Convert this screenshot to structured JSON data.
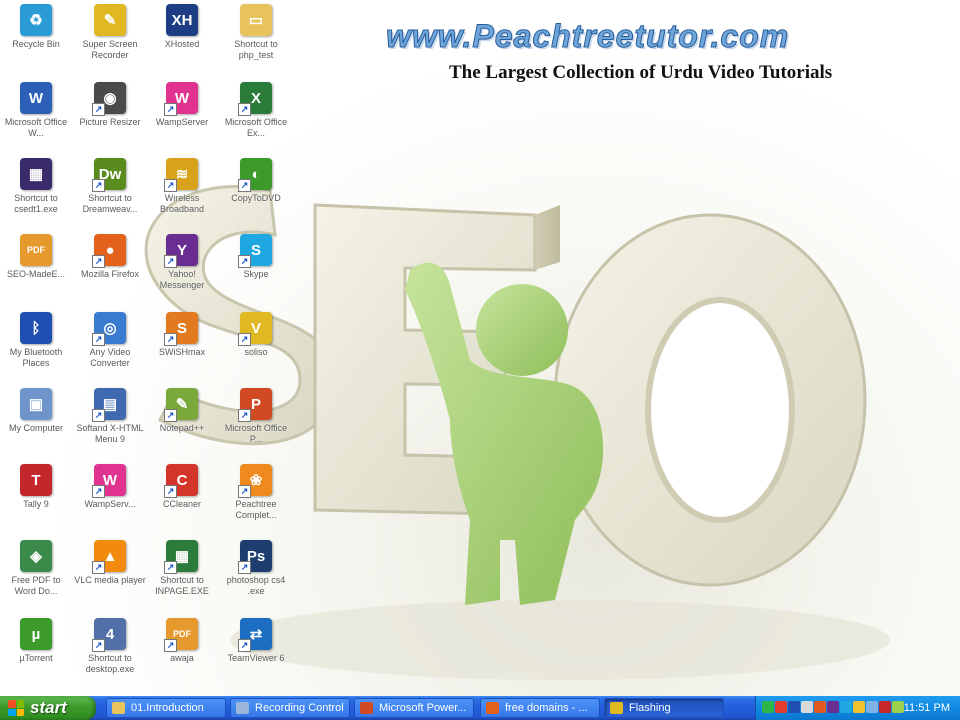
{
  "banner": {
    "url": "www.Peachtreetutor.com",
    "tagline": "The Largest Collection of Urdu Video Tutorials"
  },
  "desktop": {
    "icons": [
      {
        "label": "Recycle Bin",
        "icon": "recycle-bin-icon",
        "color": "#2b9bd6",
        "glyph": "♻"
      },
      {
        "label": "Microsoft Office W...",
        "icon": "word-icon",
        "color": "#2b5fb8",
        "glyph": "W"
      },
      {
        "label": "Shortcut to csedt1.exe",
        "icon": "exe-icon",
        "color": "#3a2c6a",
        "glyph": "▦"
      },
      {
        "label": "SEO-MadeE...",
        "icon": "pdf-icon",
        "color": "#e69a2e",
        "glyph": "PDF"
      },
      {
        "label": "My Bluetooth Places",
        "icon": "bluetooth-icon",
        "color": "#1f4fb3",
        "glyph": "ᛒ"
      },
      {
        "label": "My Computer",
        "icon": "computer-icon",
        "color": "#6f94c9",
        "glyph": "▣"
      },
      {
        "label": "Tally 9",
        "icon": "tally-icon",
        "color": "#c3262b",
        "glyph": "T"
      },
      {
        "label": "Free PDF to Word Do...",
        "icon": "pdf-to-word-icon",
        "color": "#3b8a4a",
        "glyph": "◈"
      },
      {
        "label": "µTorrent",
        "icon": "utorrent-icon",
        "color": "#3b9a2b",
        "glyph": "µ"
      },
      {
        "label": "Super Screen Recorder",
        "icon": "screen-recorder-icon",
        "color": "#e0b821",
        "glyph": "✎"
      },
      {
        "label": "Picture Resizer",
        "icon": "camera-icon",
        "color": "#4a4a4a",
        "glyph": "◉"
      },
      {
        "label": "Shortcut to Dreamweav...",
        "icon": "dreamweaver-icon",
        "color": "#5a8b1e",
        "glyph": "Dw"
      },
      {
        "label": "Mozilla Firefox",
        "icon": "firefox-icon",
        "color": "#e2621c",
        "glyph": "●"
      },
      {
        "label": "Any Video Converter",
        "icon": "video-converter-icon",
        "color": "#3a7bd0",
        "glyph": "◎"
      },
      {
        "label": "Softand X-HTML Menu 9",
        "icon": "html-menu-icon",
        "color": "#3f6ab1",
        "glyph": "▤"
      },
      {
        "label": "WampServ...",
        "icon": "wampserver-icon",
        "color": "#e0338f",
        "glyph": "W"
      },
      {
        "label": "VLC media player",
        "icon": "vlc-icon",
        "color": "#f28a0c",
        "glyph": "▲"
      },
      {
        "label": "Shortcut to desktop.exe",
        "icon": "shortcut-icon",
        "color": "#5270a8",
        "glyph": "4"
      },
      {
        "label": "XHosted",
        "icon": "xh-icon",
        "color": "#1d3e84",
        "glyph": "XH"
      },
      {
        "label": "WampServer",
        "icon": "wampserver-icon",
        "color": "#e0338f",
        "glyph": "W"
      },
      {
        "label": "Wireless Broadband",
        "icon": "wireless-icon",
        "color": "#d8a31a",
        "glyph": "≋"
      },
      {
        "label": "Yahoo! Messenger",
        "icon": "yahoo-icon",
        "color": "#6a2d91",
        "glyph": "Y"
      },
      {
        "label": "SWiSHmax",
        "icon": "swish-icon",
        "color": "#e27b1f",
        "glyph": "S"
      },
      {
        "label": "Notepad++",
        "icon": "notepad-icon",
        "color": "#7aa83b",
        "glyph": "✎"
      },
      {
        "label": "CCleaner",
        "icon": "ccleaner-icon",
        "color": "#d4352b",
        "glyph": "C"
      },
      {
        "label": "Shortcut to INPAGE.EXE",
        "icon": "inpage-icon",
        "color": "#2b7b3a",
        "glyph": "▦"
      },
      {
        "label": "awaja",
        "icon": "pdf-icon",
        "color": "#e69a2e",
        "glyph": "PDF"
      },
      {
        "label": "Shortcut to php_test",
        "icon": "folder-icon",
        "color": "#e8c25a",
        "glyph": "▭"
      },
      {
        "label": "Microsoft Office Ex...",
        "icon": "excel-icon",
        "color": "#2b7b3a",
        "glyph": "X"
      },
      {
        "label": "CopyToDVD",
        "icon": "copytodvd-icon",
        "color": "#3c9a2b",
        "glyph": "◐"
      },
      {
        "label": "Skype",
        "icon": "skype-icon",
        "color": "#1ea7e1",
        "glyph": "S"
      },
      {
        "label": "soliso",
        "icon": "soliso-icon",
        "color": "#e0b821",
        "glyph": "V"
      },
      {
        "label": "Microsoft Office P...",
        "icon": "powerpoint-icon",
        "color": "#d24a24",
        "glyph": "P"
      },
      {
        "label": "Peachtree Complet...",
        "icon": "peachtree-icon",
        "color": "#ef8a1e",
        "glyph": "❀"
      },
      {
        "label": "photoshop cs4 .exe",
        "icon": "photoshop-icon",
        "color": "#1c3d6e",
        "glyph": "Ps"
      },
      {
        "label": "TeamViewer 6",
        "icon": "teamviewer-icon",
        "color": "#1b6ec2",
        "glyph": "⇄"
      }
    ]
  },
  "taskbar": {
    "start_label": "start",
    "tasks": [
      {
        "label": "01.Introduction",
        "icon": "folder-icon",
        "color": "#e8c25a",
        "active": false
      },
      {
        "label": "Recording Control",
        "icon": "recording-icon",
        "color": "#9bb5d8",
        "active": false
      },
      {
        "label": "Microsoft Power...",
        "icon": "powerpoint-icon",
        "color": "#d24a24",
        "active": false
      },
      {
        "label": "free domains - ...",
        "icon": "firefox-icon",
        "color": "#e2621c",
        "active": false
      },
      {
        "label": "Flashing",
        "icon": "flash-icon",
        "color": "#e0b821",
        "active": true
      }
    ],
    "tray_icons": [
      {
        "name": "network-icon",
        "color": "#2db54a"
      },
      {
        "name": "shield-icon",
        "color": "#e53b2c"
      },
      {
        "name": "bluetooth-icon",
        "color": "#1f4fb3"
      },
      {
        "name": "volume-icon",
        "color": "#d8d8d8"
      },
      {
        "name": "antivirus-icon",
        "color": "#e05a1f"
      },
      {
        "name": "messenger-icon",
        "color": "#6a2d91"
      },
      {
        "name": "skype-icon",
        "color": "#1ea7e1"
      },
      {
        "name": "update-icon",
        "color": "#f2c12e"
      },
      {
        "name": "monitor-icon",
        "color": "#7fb2e6"
      },
      {
        "name": "security-icon",
        "color": "#c62828"
      },
      {
        "name": "wifi-icon",
        "color": "#9ad04a"
      }
    ],
    "clock": "11:51 PM"
  }
}
